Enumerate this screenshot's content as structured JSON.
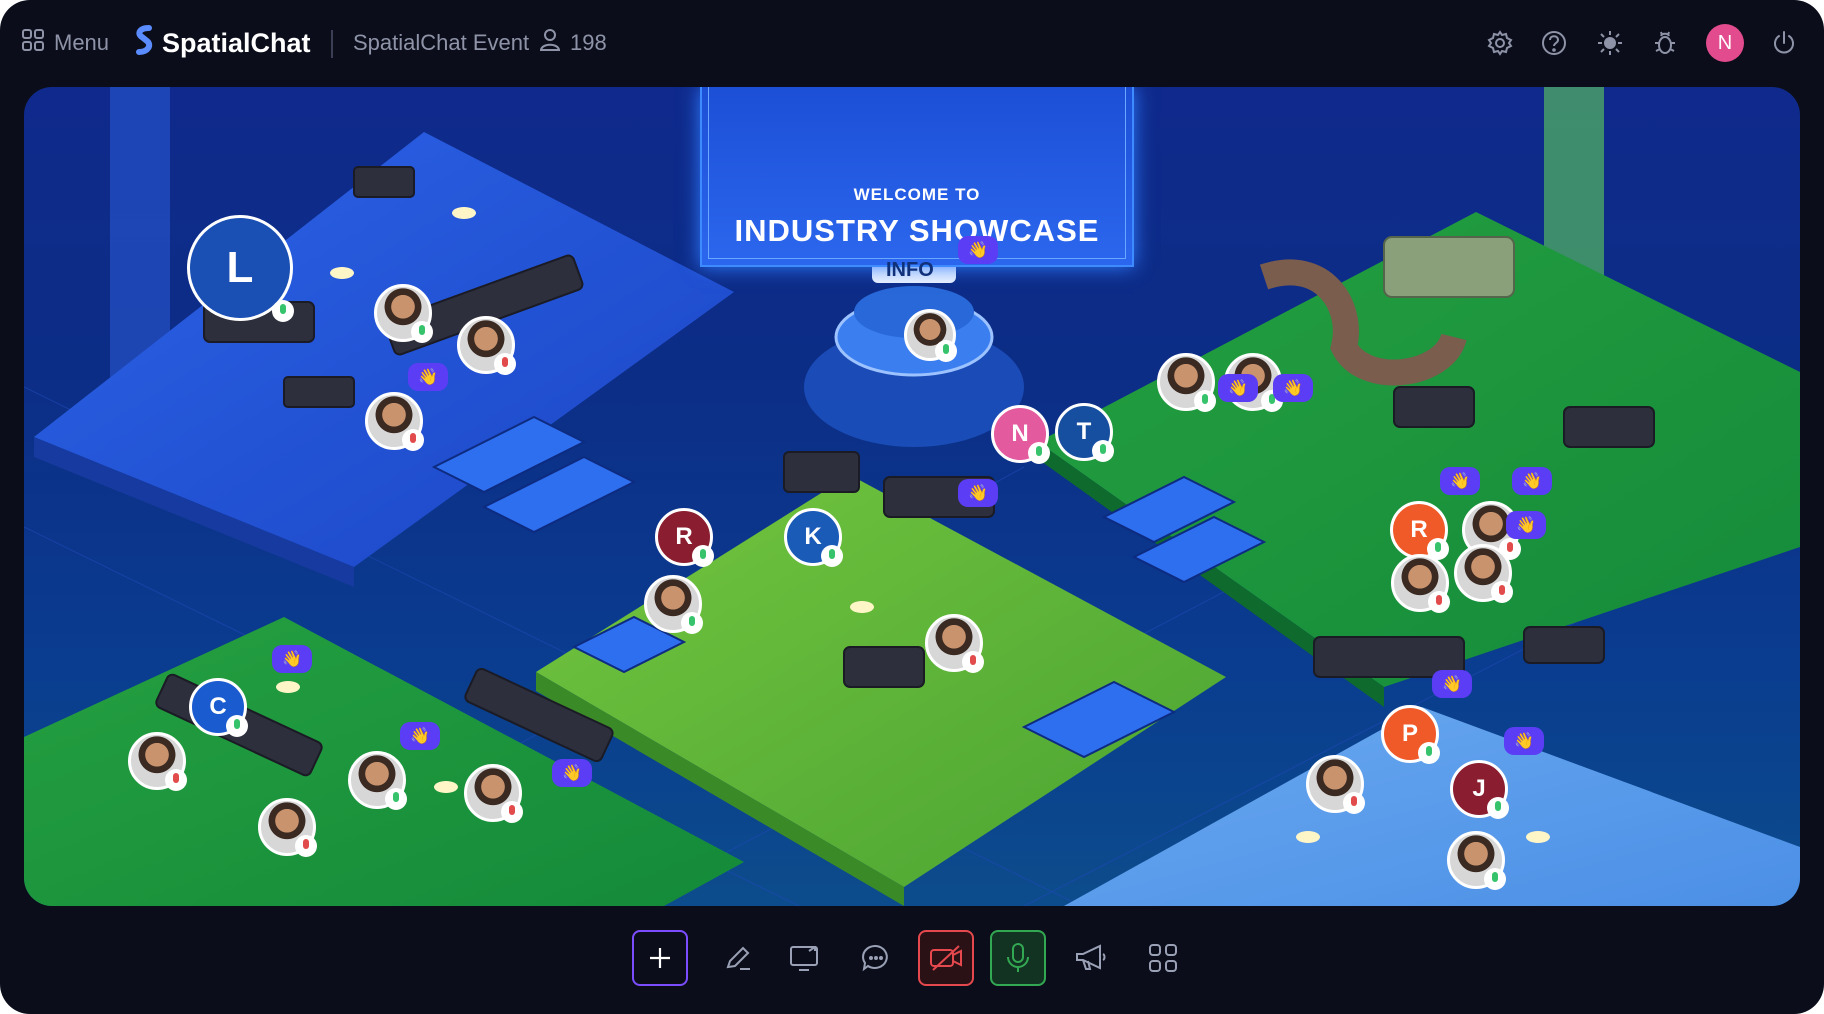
{
  "topbar": {
    "menu_label": "Menu",
    "app_name": "SpatialChat",
    "event_name": "SpatialChat Event",
    "participant_count": "198",
    "user_initial": "N"
  },
  "map": {
    "sign_subtitle": "WELCOME TO",
    "sign_title": "INDUSTRY SHOWCASE",
    "info_label": "INFO",
    "avatars": [
      "L",
      "N",
      "T",
      "R",
      "K",
      "C",
      "R",
      "P",
      "J"
    ]
  },
  "toolbar": {
    "buttons": [
      "add",
      "draw",
      "screen-share",
      "chat",
      "camera-off",
      "microphone-on",
      "announce",
      "apps"
    ]
  },
  "colors": {
    "background": "#0b0e1a",
    "accent_purple": "#7c4dff",
    "camera_off_red": "#e5484d",
    "mic_on_green": "#33a852",
    "avatar_pink": "#e24b8e"
  }
}
